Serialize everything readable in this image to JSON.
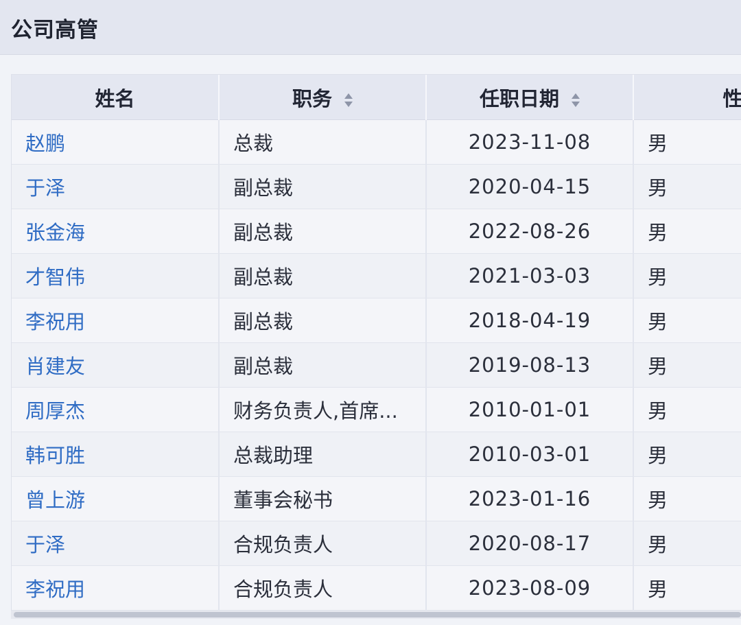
{
  "panel": {
    "title": "公司高管"
  },
  "table": {
    "headers": {
      "name": "姓名",
      "role": "职务",
      "date": "任职日期",
      "sex": "性别"
    },
    "rows": [
      {
        "name": "赵鹏",
        "role": "总裁",
        "date": "2023-11-08",
        "sex": "男"
      },
      {
        "name": "于泽",
        "role": "副总裁",
        "date": "2020-04-15",
        "sex": "男"
      },
      {
        "name": "张金海",
        "role": "副总裁",
        "date": "2022-08-26",
        "sex": "男"
      },
      {
        "name": "才智伟",
        "role": "副总裁",
        "date": "2021-03-03",
        "sex": "男"
      },
      {
        "name": "李祝用",
        "role": "副总裁",
        "date": "2018-04-19",
        "sex": "男"
      },
      {
        "name": "肖建友",
        "role": "副总裁",
        "date": "2019-08-13",
        "sex": "男"
      },
      {
        "name": "周厚杰",
        "role": "财务负责人,首席...",
        "date": "2010-01-01",
        "sex": "男"
      },
      {
        "name": "韩可胜",
        "role": "总裁助理",
        "date": "2010-03-01",
        "sex": "男"
      },
      {
        "name": "曾上游",
        "role": "董事会秘书",
        "date": "2023-01-16",
        "sex": "男"
      },
      {
        "name": "于泽",
        "role": "合规负责人",
        "date": "2020-08-17",
        "sex": "男"
      },
      {
        "name": "李祝用",
        "role": "合规负责人",
        "date": "2023-08-09",
        "sex": "男"
      }
    ]
  },
  "colors": {
    "link": "#2f6cc4",
    "header_bg": "#e4e7f1",
    "title_bg": "#e3e6f0"
  }
}
